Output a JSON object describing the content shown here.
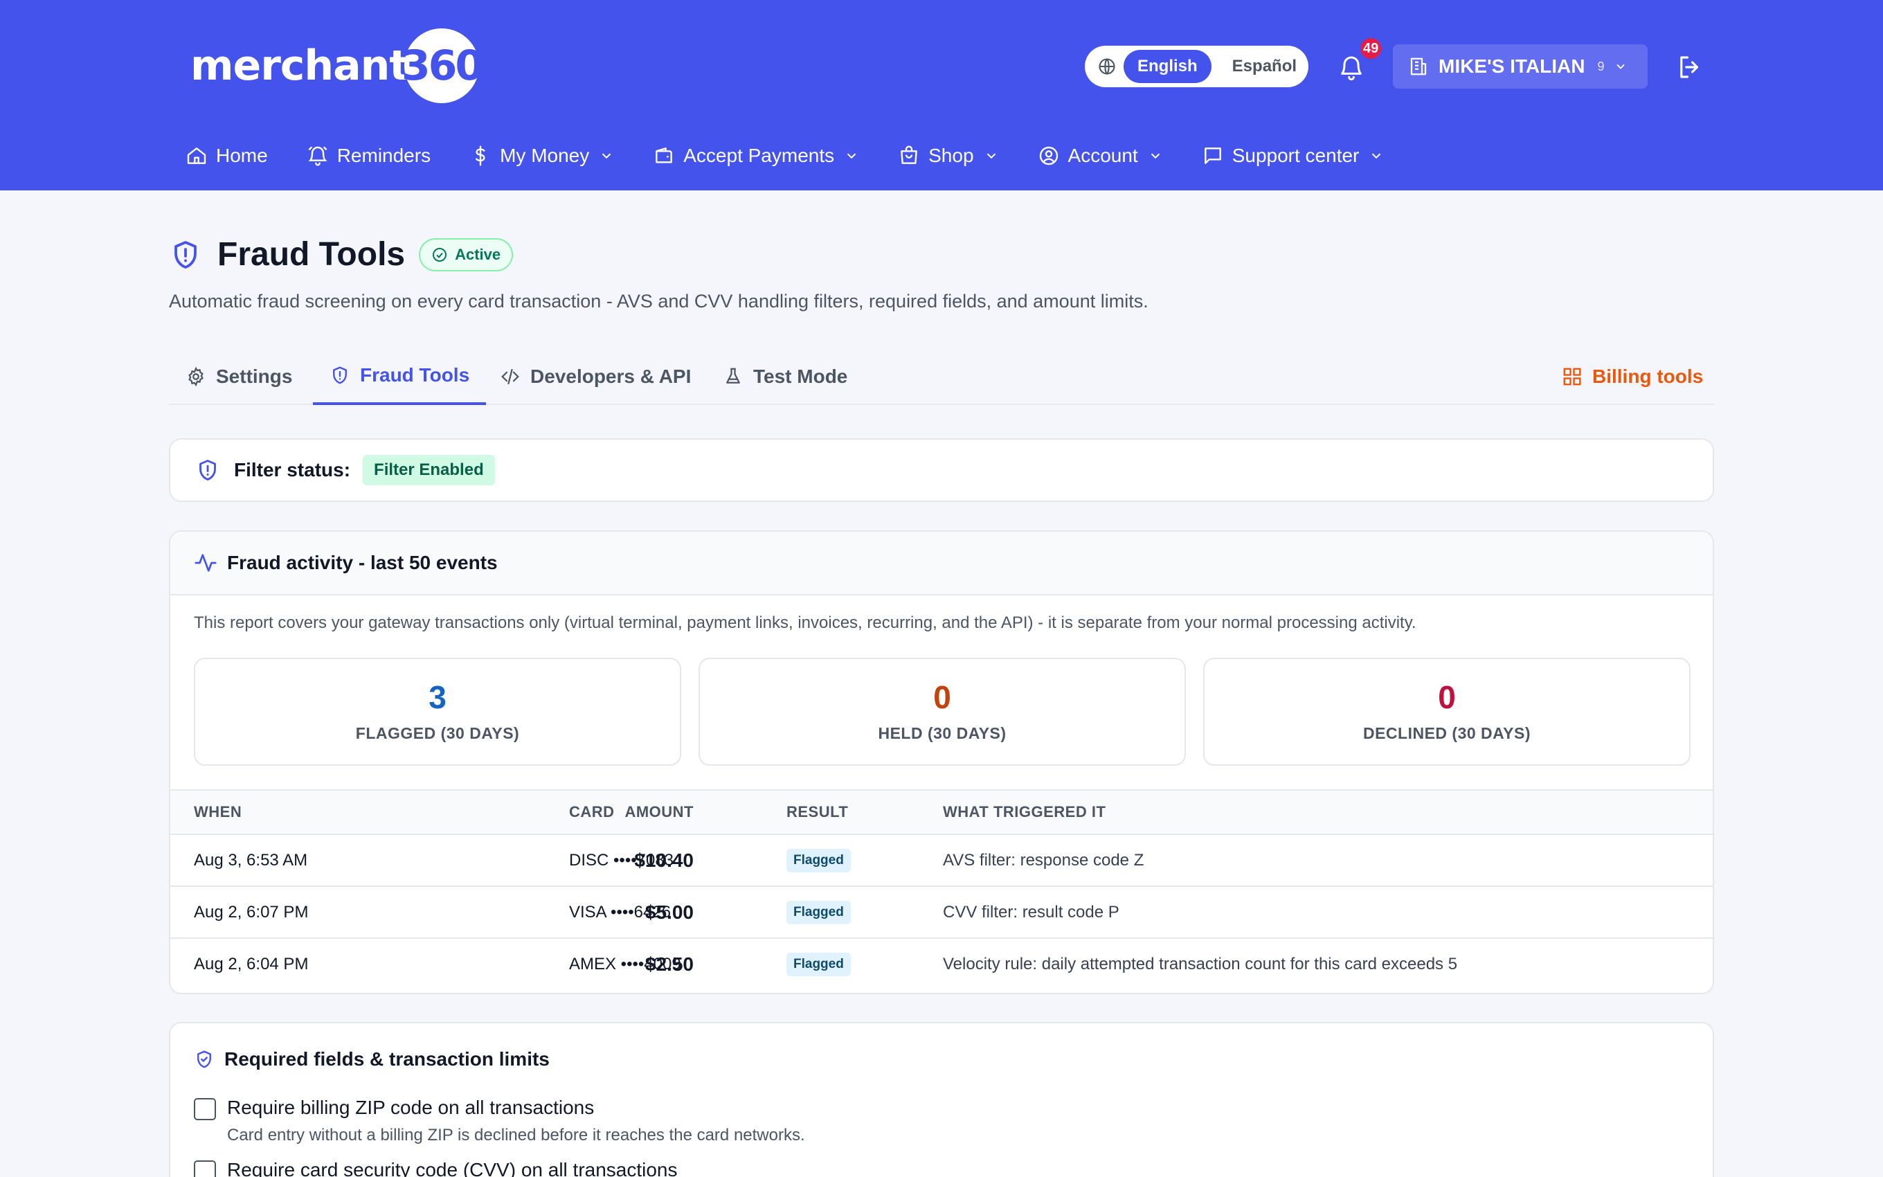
{
  "brand": {
    "name": "merchant",
    "badge": "360"
  },
  "language": {
    "active": "English",
    "other": "Español"
  },
  "notifications": {
    "count": "49"
  },
  "merchant": {
    "name": "MIKE'S ITALIAN",
    "count": "9"
  },
  "nav": {
    "home": "Home",
    "reminders": "Reminders",
    "my_money": "My Money",
    "accept_payments": "Accept Payments",
    "shop": "Shop",
    "account": "Account",
    "support": "Support center"
  },
  "page": {
    "title": "Fraud Tools",
    "status": "Active",
    "description": "Automatic fraud screening on every card transaction - AVS and CVV handling filters, required fields, and amount limits."
  },
  "tabs": {
    "settings": "Settings",
    "fraud_tools": "Fraud Tools",
    "developers": "Developers & API",
    "test_mode": "Test Mode",
    "billing": "Billing tools"
  },
  "filter": {
    "label": "Filter status:",
    "value": "Filter Enabled"
  },
  "activity": {
    "title": "Fraud activity - last 50 events",
    "note": "This report covers your gateway transactions only (virtual terminal, payment links, invoices, recurring, and the API) - it is separate from your normal processing activity.",
    "stats": {
      "flagged": {
        "value": "3",
        "label": "FLAGGED (30 DAYS)",
        "color": "#1565c0"
      },
      "held": {
        "value": "0",
        "label": "HELD (30 DAYS)",
        "color": "#c2410c"
      },
      "declined": {
        "value": "0",
        "label": "DECLINED (30 DAYS)",
        "color": "#be123c"
      }
    },
    "columns": {
      "when": "WHEN",
      "amount": "AMOUNT",
      "card": "CARD",
      "result": "RESULT",
      "trigger": "WHAT TRIGGERED IT"
    },
    "rows": [
      {
        "when": "Aug 3, 6:53 AM",
        "amount": "$10.40",
        "card": "DISC ••••7083",
        "result": "Flagged",
        "trigger": "AVS filter: response code Z"
      },
      {
        "when": "Aug 2, 6:07 PM",
        "amount": "$5.00",
        "card": "VISA ••••6426",
        "result": "Flagged",
        "trigger": "CVV filter: result code P"
      },
      {
        "when": "Aug 2, 6:04 PM",
        "amount": "$2.50",
        "card": "AMEX ••••4009",
        "result": "Flagged",
        "trigger": "Velocity rule: daily attempted transaction count for this card exceeds 5"
      }
    ]
  },
  "required": {
    "title": "Required fields & transaction limits",
    "zip": {
      "label": "Require billing ZIP code on all transactions",
      "help": "Card entry without a billing ZIP is declined before it reaches the card networks."
    },
    "cvv": {
      "label": "Require card security code (CVV) on all transactions"
    }
  },
  "colors": {
    "brand": "#4453ec",
    "billing": "#ea580c",
    "active_green": "#047857"
  }
}
